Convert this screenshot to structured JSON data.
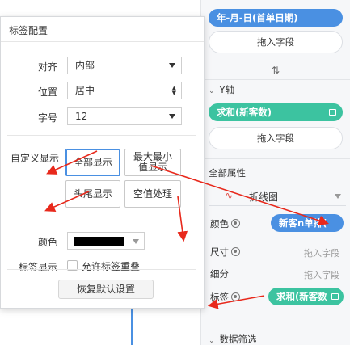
{
  "canvas": {
    "accent": "#4a90e2",
    "pill_green": "#3cc3a0",
    "arrow_color": "#e8291c"
  },
  "right_panel": {
    "date_pill": "年-月-日(首单日期)",
    "drop_label_1": "拖入字段",
    "swap_icon_text": "⇅",
    "y_axis_label": "Y轴",
    "y_pill": "求和(新客数)",
    "drop_label_2": "拖入字段",
    "global_props_label": "全部属性",
    "chart_type": "折线图",
    "color_label": "颜色",
    "color_pill": "新客n单排(",
    "size_label": "尺寸",
    "size_hint": "拖入字段",
    "detail_label": "细分",
    "detail_hint": "拖入字段",
    "label_label": "标签",
    "label_pill": "求和(新客数",
    "data_filter_label": "数据筛选"
  },
  "dialog": {
    "title": "标签配置",
    "align_label": "对齐",
    "align_value": "内部",
    "position_label": "位置",
    "position_value": "居中",
    "fontsize_label": "字号",
    "fontsize_value": "12",
    "custom_display_label": "自定义显示",
    "btn_show_all": "全部显示",
    "btn_max_min_line1": "最大最小",
    "btn_max_min_line2": "值显示",
    "btn_head_tail": "头尾显示",
    "btn_null_handling": "空值处理",
    "color_label": "颜色",
    "color_value": "#000000",
    "label_display_label": "标签显示",
    "allow_overlap_label": "允许标签重叠",
    "allow_overlap_checked": false,
    "reset_button": "恢复默认设置"
  }
}
